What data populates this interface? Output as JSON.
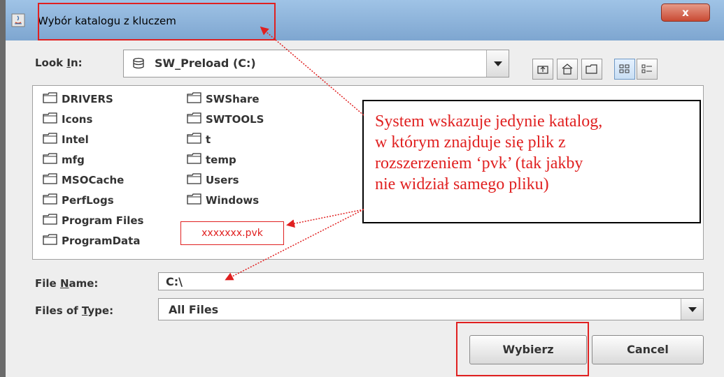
{
  "window": {
    "title": "Wybór katalogu z kluczem",
    "close_symbol": "x",
    "accent_titlebar": "#9fc3e6",
    "close_color": "#c94a33"
  },
  "look_in": {
    "label_pre": "Look ",
    "label_u": "I",
    "label_post": "n:",
    "value": "SW_Preload (C:)",
    "icon": "drive-icon"
  },
  "toolbar": {
    "icons": [
      "up-folder-icon",
      "home-icon",
      "new-folder-icon",
      "list-view-icon",
      "details-view-icon"
    ]
  },
  "files": {
    "column1": [
      "DRIVERS",
      "Icons",
      "Intel",
      "mfg",
      "MSOCache",
      "PerfLogs",
      "Program Files",
      "ProgramData"
    ],
    "column2": [
      "SWShare",
      "SWTOOLS",
      "t",
      "temp",
      "Users",
      "Windows"
    ]
  },
  "annotation": {
    "pvk_file": "xxxxxxx.pvk",
    "callout_lines": [
      "System wskazuje jedynie katalog,",
      "w którym znajduje się plik z",
      "rozszerzeniem ‘pvk’ (tak jakby",
      "nie widział samego pliku)"
    ],
    "highlight_color": "#e02020"
  },
  "file_name": {
    "label_pre": "File ",
    "label_u": "N",
    "label_post": "ame:",
    "value": "C:\\"
  },
  "file_type": {
    "label_pre": "Files of ",
    "label_u": "T",
    "label_post": "ype:",
    "value": "All Files"
  },
  "buttons": {
    "choose": "Wybierz",
    "cancel": "Cancel"
  }
}
